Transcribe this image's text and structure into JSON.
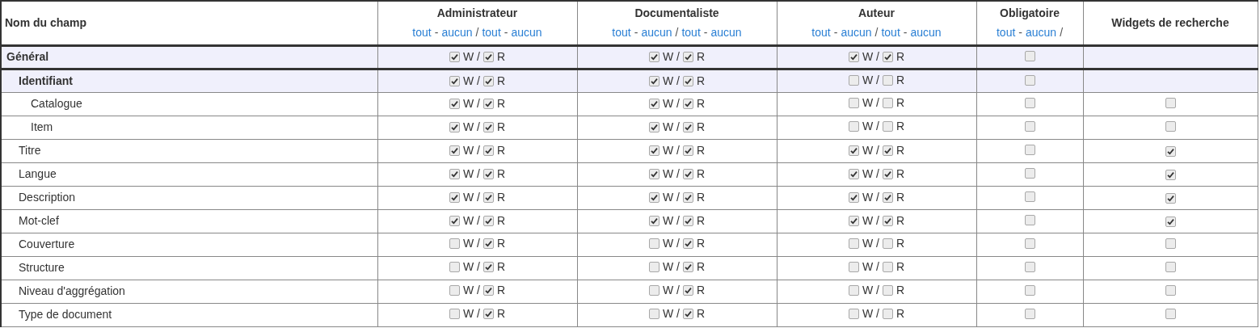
{
  "table": {
    "columns": [
      {
        "kind": "name",
        "title": "Nom du champ"
      },
      {
        "kind": "role",
        "title": "Administrateur",
        "links": [
          {
            "kind": "link",
            "text": "tout"
          },
          {
            "kind": "sep",
            "text": "-"
          },
          {
            "kind": "link",
            "text": "aucun"
          },
          {
            "kind": "sep",
            "text": "/"
          },
          {
            "kind": "link",
            "text": "tout"
          },
          {
            "kind": "sep",
            "text": "-"
          },
          {
            "kind": "link",
            "text": "aucun"
          }
        ]
      },
      {
        "kind": "role",
        "title": "Documentaliste",
        "links": [
          {
            "kind": "link",
            "text": "tout"
          },
          {
            "kind": "sep",
            "text": "-"
          },
          {
            "kind": "link",
            "text": "aucun"
          },
          {
            "kind": "sep",
            "text": "/"
          },
          {
            "kind": "link",
            "text": "tout"
          },
          {
            "kind": "sep",
            "text": "-"
          },
          {
            "kind": "link",
            "text": "aucun"
          }
        ]
      },
      {
        "kind": "role",
        "title": "Auteur",
        "links": [
          {
            "kind": "link",
            "text": "tout"
          },
          {
            "kind": "sep",
            "text": "-"
          },
          {
            "kind": "link",
            "text": "aucun"
          },
          {
            "kind": "sep",
            "text": "/"
          },
          {
            "kind": "link",
            "text": "tout"
          },
          {
            "kind": "sep",
            "text": "-"
          },
          {
            "kind": "link",
            "text": "aucun"
          }
        ]
      },
      {
        "kind": "required",
        "title": "Obligatoire",
        "links": [
          {
            "kind": "link",
            "text": "tout"
          },
          {
            "kind": "sep",
            "text": "-"
          },
          {
            "kind": "link",
            "text": "aucun"
          },
          {
            "kind": "sep",
            "text": "/"
          }
        ]
      },
      {
        "kind": "widget",
        "title": "Widgets de recherche"
      }
    ],
    "rows": [
      {
        "name": "Général",
        "roles": [
          {
            "w": true,
            "w_label": "W",
            "sep": "/",
            "r": true,
            "r_label": "R"
          },
          {
            "w": true,
            "w_label": "W",
            "sep": "/",
            "r": true,
            "r_label": "R"
          },
          {
            "w": true,
            "w_label": "W",
            "sep": "/",
            "r": true,
            "r_label": "R"
          }
        ],
        "required": false,
        "children": [
          {
            "name": "Identifiant",
            "roles": [
              {
                "w": true,
                "w_label": "W",
                "sep": "/",
                "r": true,
                "r_label": "R"
              },
              {
                "w": true,
                "w_label": "W",
                "sep": "/",
                "r": true,
                "r_label": "R"
              },
              {
                "w": false,
                "w_label": "W",
                "sep": "/",
                "r": false,
                "r_label": "R"
              }
            ],
            "required": false,
            "children": [
              {
                "name": "Catalogue",
                "roles": [
                  {
                    "w": true,
                    "w_label": "W",
                    "sep": "/",
                    "r": true,
                    "r_label": "R"
                  },
                  {
                    "w": true,
                    "w_label": "W",
                    "sep": "/",
                    "r": true,
                    "r_label": "R"
                  },
                  {
                    "w": false,
                    "w_label": "W",
                    "sep": "/",
                    "r": false,
                    "r_label": "R"
                  }
                ],
                "required": false,
                "widget": false
              },
              {
                "name": "Item",
                "roles": [
                  {
                    "w": true,
                    "w_label": "W",
                    "sep": "/",
                    "r": true,
                    "r_label": "R"
                  },
                  {
                    "w": true,
                    "w_label": "W",
                    "sep": "/",
                    "r": true,
                    "r_label": "R"
                  },
                  {
                    "w": false,
                    "w_label": "W",
                    "sep": "/",
                    "r": false,
                    "r_label": "R"
                  }
                ],
                "required": false,
                "widget": false
              }
            ]
          },
          {
            "name": "Titre",
            "roles": [
              {
                "w": true,
                "w_label": "W",
                "sep": "/",
                "r": true,
                "r_label": "R"
              },
              {
                "w": true,
                "w_label": "W",
                "sep": "/",
                "r": true,
                "r_label": "R"
              },
              {
                "w": true,
                "w_label": "W",
                "sep": "/",
                "r": true,
                "r_label": "R"
              }
            ],
            "required": false,
            "widget": true
          },
          {
            "name": "Langue",
            "roles": [
              {
                "w": true,
                "w_label": "W",
                "sep": "/",
                "r": true,
                "r_label": "R"
              },
              {
                "w": true,
                "w_label": "W",
                "sep": "/",
                "r": true,
                "r_label": "R"
              },
              {
                "w": true,
                "w_label": "W",
                "sep": "/",
                "r": true,
                "r_label": "R"
              }
            ],
            "required": false,
            "widget": true
          },
          {
            "name": "Description",
            "roles": [
              {
                "w": true,
                "w_label": "W",
                "sep": "/",
                "r": true,
                "r_label": "R"
              },
              {
                "w": true,
                "w_label": "W",
                "sep": "/",
                "r": true,
                "r_label": "R"
              },
              {
                "w": true,
                "w_label": "W",
                "sep": "/",
                "r": true,
                "r_label": "R"
              }
            ],
            "required": false,
            "widget": true
          },
          {
            "name": "Mot-clef",
            "roles": [
              {
                "w": true,
                "w_label": "W",
                "sep": "/",
                "r": true,
                "r_label": "R"
              },
              {
                "w": true,
                "w_label": "W",
                "sep": "/",
                "r": true,
                "r_label": "R"
              },
              {
                "w": true,
                "w_label": "W",
                "sep": "/",
                "r": true,
                "r_label": "R"
              }
            ],
            "required": false,
            "widget": true
          },
          {
            "name": "Couverture",
            "roles": [
              {
                "w": false,
                "w_label": "W",
                "sep": "/",
                "r": true,
                "r_label": "R"
              },
              {
                "w": false,
                "w_label": "W",
                "sep": "/",
                "r": true,
                "r_label": "R"
              },
              {
                "w": false,
                "w_label": "W",
                "sep": "/",
                "r": false,
                "r_label": "R"
              }
            ],
            "required": false,
            "widget": false
          },
          {
            "name": "Structure",
            "roles": [
              {
                "w": false,
                "w_label": "W",
                "sep": "/",
                "r": true,
                "r_label": "R"
              },
              {
                "w": false,
                "w_label": "W",
                "sep": "/",
                "r": true,
                "r_label": "R"
              },
              {
                "w": false,
                "w_label": "W",
                "sep": "/",
                "r": false,
                "r_label": "R"
              }
            ],
            "required": false,
            "widget": false
          },
          {
            "name": "Niveau d'aggrégation",
            "roles": [
              {
                "w": false,
                "w_label": "W",
                "sep": "/",
                "r": true,
                "r_label": "R"
              },
              {
                "w": false,
                "w_label": "W",
                "sep": "/",
                "r": true,
                "r_label": "R"
              },
              {
                "w": false,
                "w_label": "W",
                "sep": "/",
                "r": false,
                "r_label": "R"
              }
            ],
            "required": false,
            "widget": false
          },
          {
            "name": "Type de document",
            "roles": [
              {
                "w": false,
                "w_label": "W",
                "sep": "/",
                "r": true,
                "r_label": "R"
              },
              {
                "w": false,
                "w_label": "W",
                "sep": "/",
                "r": true,
                "r_label": "R"
              },
              {
                "w": false,
                "w_label": "W",
                "sep": "/",
                "r": false,
                "r_label": "R"
              }
            ],
            "required": false,
            "widget": false
          }
        ]
      }
    ]
  }
}
